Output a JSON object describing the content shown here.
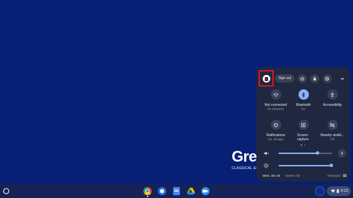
{
  "wallpaper": {
    "logo_text": "Gre",
    "logo_subtext": "CLASSICAL EDU"
  },
  "quick_settings": {
    "sign_out_label": "Sign out",
    "tiles": [
      {
        "label": "Not connected",
        "sublabel": "No networks",
        "icon": "wifi-icon",
        "active": false
      },
      {
        "label": "Bluetooth",
        "sublabel": "On",
        "icon": "bluetooth-icon",
        "active": true
      },
      {
        "label": "Accessibility",
        "sublabel": "",
        "icon": "accessibility-icon",
        "active": false
      },
      {
        "label": "Notifications",
        "sublabel": "On, all apps",
        "icon": "notifications-icon",
        "active": false
      },
      {
        "label": "Screen capture",
        "sublabel": "",
        "icon": "screen-capture-icon",
        "active": false
      },
      {
        "label": "Nearby visibil...",
        "sublabel": "Off",
        "icon": "nearby-share-icon",
        "active": false
      }
    ],
    "volume_level": 0.72,
    "brightness_level": 0.97,
    "date": "Wed, Jan 26",
    "battery": "Battery full",
    "managed": "Managed"
  },
  "shelf": {
    "apps": [
      "chrome-icon",
      "app-icon",
      "docs-icon",
      "drive-icon",
      "meet-icon"
    ],
    "time": "8:23"
  },
  "colors": {
    "wallpaper": "#072075",
    "accent": "#8ab4f8",
    "highlight": "#e2141b"
  }
}
